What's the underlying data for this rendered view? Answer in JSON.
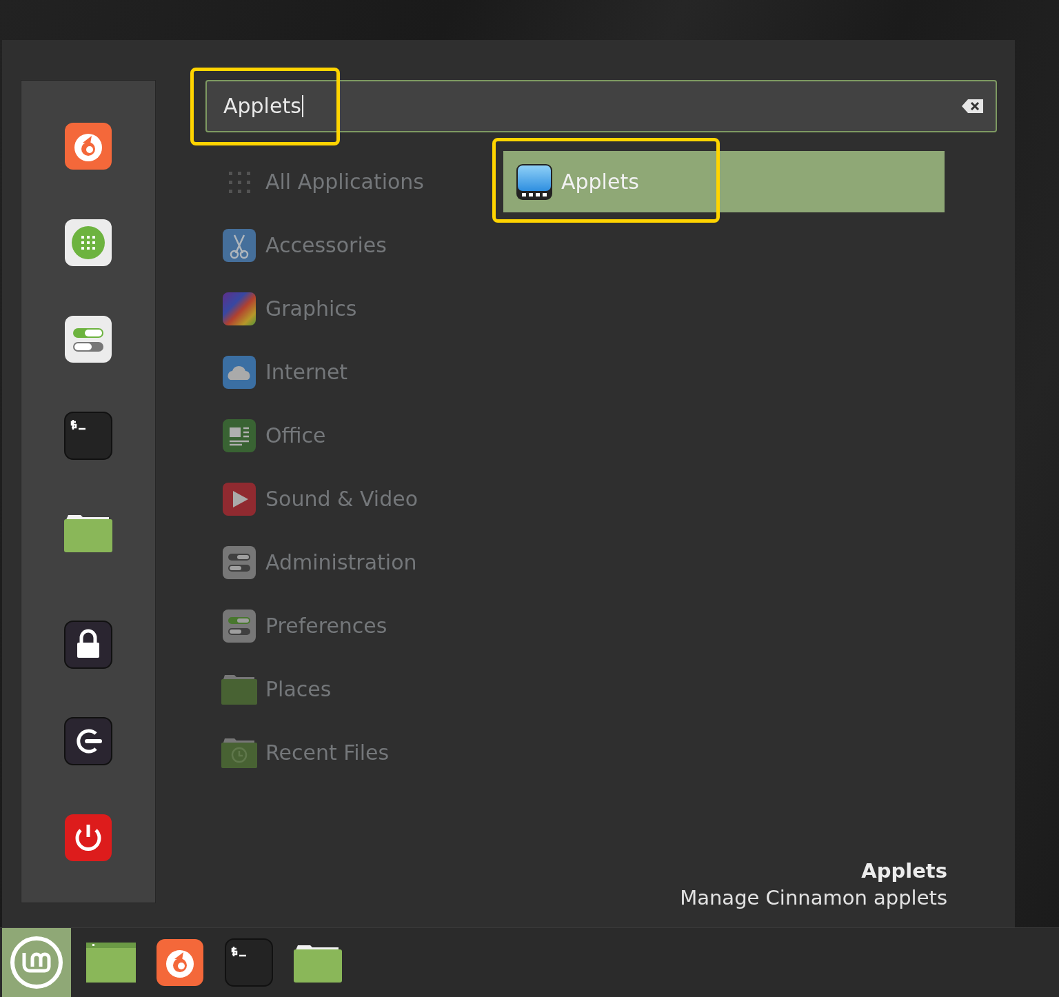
{
  "search": {
    "value": "Applets",
    "focused": true,
    "highlighted": true
  },
  "categories": [
    {
      "label": "All Applications",
      "kind": "all"
    },
    {
      "label": "Accessories",
      "kind": "accessories"
    },
    {
      "label": "Graphics",
      "kind": "graphics"
    },
    {
      "label": "Internet",
      "kind": "internet"
    },
    {
      "label": "Office",
      "kind": "office"
    },
    {
      "label": "Sound & Video",
      "kind": "media"
    },
    {
      "label": "Administration",
      "kind": "admin"
    },
    {
      "label": "Preferences",
      "kind": "prefs"
    },
    {
      "label": "Places",
      "kind": "folder"
    },
    {
      "label": "Recent Files",
      "kind": "recent"
    }
  ],
  "results": [
    {
      "label": "Applets",
      "selected": true,
      "highlighted": true
    }
  ],
  "description": {
    "title": "Applets",
    "text": "Manage Cinnamon applets"
  },
  "taskbar": {
    "menu_button": {
      "selected": true
    }
  }
}
